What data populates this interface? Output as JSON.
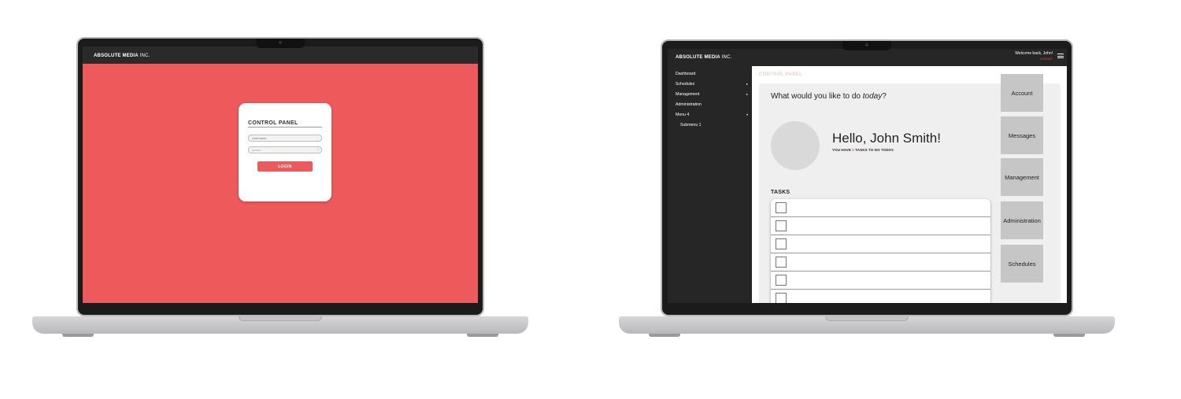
{
  "login_screen": {
    "brand_bold": "ABSOLUTE MEDIA",
    "brand_rest": " INC.",
    "title": "CONTROL PANEL",
    "username_placeholder": "Username",
    "password_value": "••••••••",
    "login_label": "LOGIN",
    "colors": {
      "accent": "#ee5a5c",
      "card": "#ffffff",
      "topbar": "#2a2a2a"
    }
  },
  "dashboard_screen": {
    "brand_bold": "ABSOLUTE MEDIA",
    "brand_rest": " INC.",
    "welcome": "Welcome back, John!",
    "logout": "LOGOUT",
    "sidebar": {
      "items": [
        {
          "label": "Dashboard"
        },
        {
          "label": "Schedules"
        },
        {
          "label": "Management"
        },
        {
          "label": "Administration"
        },
        {
          "label": "Menu 4"
        },
        {
          "label": "Submenu 1"
        }
      ]
    },
    "main_title": "CONTROL PANEL",
    "question_start": "What would you like to do ",
    "question_emph": "today",
    "question_end": "?",
    "greeting": "Hello, John Smith!",
    "tasks_prefix": "YOU HAVE ",
    "tasks_count": "6",
    "tasks_suffix": " TASKS TO DO TODAY.",
    "tasks_heading": "TASKS",
    "task_count_rows": 6,
    "quick_actions": [
      "Account",
      "Messages",
      "Management",
      "Administration",
      "Schedules"
    ],
    "colors": {
      "accent": "#ee5a5c",
      "sidebar": "#262626",
      "panel": "#efefef",
      "tile": "#c6c6c6"
    }
  }
}
